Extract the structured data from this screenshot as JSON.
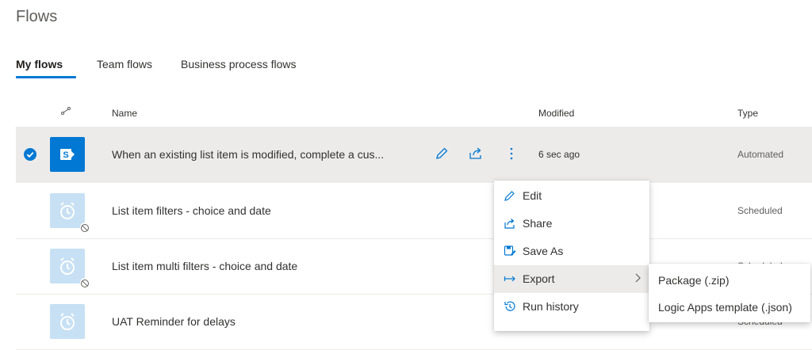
{
  "page": {
    "title": "Flows"
  },
  "tabs": [
    {
      "label": "My flows",
      "active": true
    },
    {
      "label": "Team flows",
      "active": false
    },
    {
      "label": "Business process flows",
      "active": false
    }
  ],
  "table": {
    "columns": {
      "icon": "flow-type-icon",
      "name": "Name",
      "modified": "Modified",
      "type": "Type"
    },
    "rows": [
      {
        "name": "When an existing list item is modified, complete a cus...",
        "modified": "6 sec ago",
        "type": "Automated",
        "icon": "sharepoint-icon",
        "selected": true,
        "disabled": false
      },
      {
        "name": "List item filters - choice and date",
        "modified": "",
        "type": "Scheduled",
        "icon": "alarm-clock-icon",
        "selected": false,
        "disabled": true
      },
      {
        "name": "List item multi filters - choice and date",
        "modified": "",
        "type": "Scheduled",
        "icon": "alarm-clock-icon",
        "selected": false,
        "disabled": true
      },
      {
        "name": "UAT Reminder for delays",
        "modified": "",
        "type": "Scheduled",
        "icon": "alarm-clock-icon",
        "selected": false,
        "disabled": false
      }
    ]
  },
  "row_actions": {
    "edit_icon": "pencil-icon",
    "share_icon": "share-icon",
    "more_icon": "more-vertical-icon"
  },
  "context_menu": {
    "items": [
      {
        "label": "Edit",
        "icon": "pencil-icon"
      },
      {
        "label": "Share",
        "icon": "share-icon"
      },
      {
        "label": "Save As",
        "icon": "save-as-icon"
      },
      {
        "label": "Export",
        "icon": "export-arrow-icon",
        "submenu": true,
        "highlighted": true
      },
      {
        "label": "Run history",
        "icon": "history-icon"
      }
    ]
  },
  "export_submenu": {
    "items": [
      {
        "label": "Package (.zip)"
      },
      {
        "label": "Logic Apps template (.json)"
      }
    ]
  },
  "colors": {
    "accent": "#0078d4",
    "selected_row": "#edebe9",
    "disabled_tile": "#c7e0f4",
    "text": "#323130",
    "muted": "#605e5c"
  }
}
